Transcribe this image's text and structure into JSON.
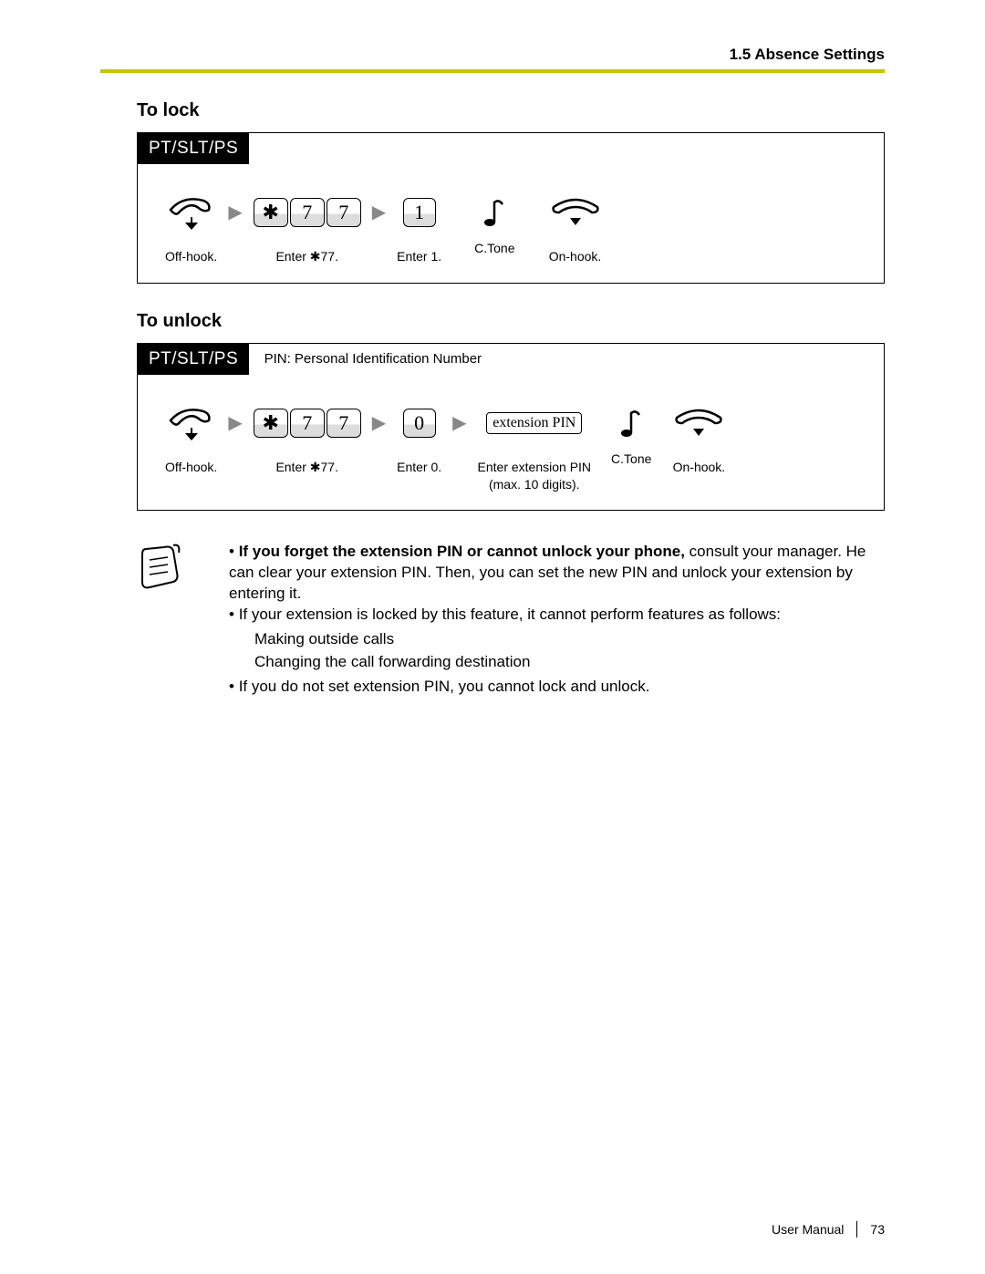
{
  "header": {
    "section": "1.5 Absence Settings"
  },
  "lock": {
    "title": "To lock",
    "tab": "PT/SLT/PS",
    "steps": {
      "offhook": "Off-hook.",
      "code_keys": [
        "✱",
        "7",
        "7"
      ],
      "code_label": "Enter ✱77.",
      "one_key": "1",
      "one_label": "Enter 1.",
      "ctone": "C.Tone",
      "onhook": "On-hook."
    }
  },
  "unlock": {
    "title": "To unlock",
    "tab": "PT/SLT/PS",
    "pin_def": "PIN: Personal Identification Number",
    "steps": {
      "offhook": "Off-hook.",
      "code_keys": [
        "✱",
        "7",
        "7"
      ],
      "code_label": "Enter ✱77.",
      "zero_key": "0",
      "zero_label": "Enter 0.",
      "pin_box": "extension PIN",
      "pin_label1": "Enter extension PIN",
      "pin_label2": "(max. 10 digits).",
      "ctone": "C.Tone",
      "onhook": "On-hook."
    }
  },
  "notes": {
    "p1_bold": "If you forget the extension PIN or cannot unlock your phone,",
    "p1_rest": " consult your manager. He can clear your extension PIN. Then, you can set the new PIN and unlock your extension by entering it.",
    "p2": "If your extension is locked by this feature, it cannot perform features as follows:",
    "b1": "Making outside calls",
    "b2": "Changing the call forwarding destination",
    "p3": "If you do not set extension PIN, you cannot lock and unlock."
  },
  "footer": {
    "label": "User Manual",
    "page": "73"
  }
}
